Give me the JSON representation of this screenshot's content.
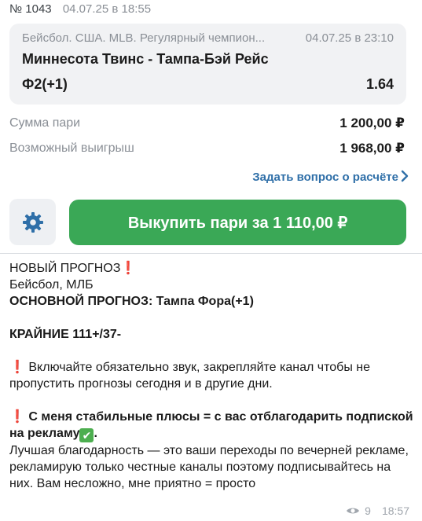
{
  "bet": {
    "number": "№ 1043",
    "placed_at": "04.07.25 в 18:55",
    "league": "Бейсбол. США. MLB. Регулярный чемпион...",
    "event_date": "04.07.25 в 23:10",
    "teams": "Миннесота Твинс - Тампа-Бэй Рейс",
    "outcome": "Ф2(+1)",
    "odds": "1.64",
    "stake_label": "Сумма пари",
    "stake_value": "1 200,00 ₽",
    "win_label": "Возможный выигрыш",
    "win_value": "1 968,00 ₽",
    "ask_link": "Задать вопрос о расчёте",
    "cashout_label": "Выкупить пари за 1 110,00 ₽"
  },
  "message": {
    "line1": "НОВЫЙ ПРОГНОЗ",
    "line2": "Бейсбол, МЛБ",
    "line3": "ОСНОВНОЙ ПРОГНОЗ: Тампа Фора(+1)",
    "line4": "КРАЙНИЕ 111+/37-",
    "p1": "Включайте обязательно звук, закрепляйте канал чтобы не пропустить прогнозы сегодня и в другие дни.",
    "p2": "С меня стабильные плюсы = с вас отблагодарить подпиской на рекламу",
    "p2_end": ".",
    "p3": "Лучшая благодарность — это ваши переходы по вечерней рекламе,  рекламирую только честные каналы поэтому подписывайтесь на них. Вам несложно, мне приятно = просто",
    "emoji_exclaim": "❗",
    "emoji_check": "✔"
  },
  "meta": {
    "views": "9",
    "time": "18:57"
  }
}
